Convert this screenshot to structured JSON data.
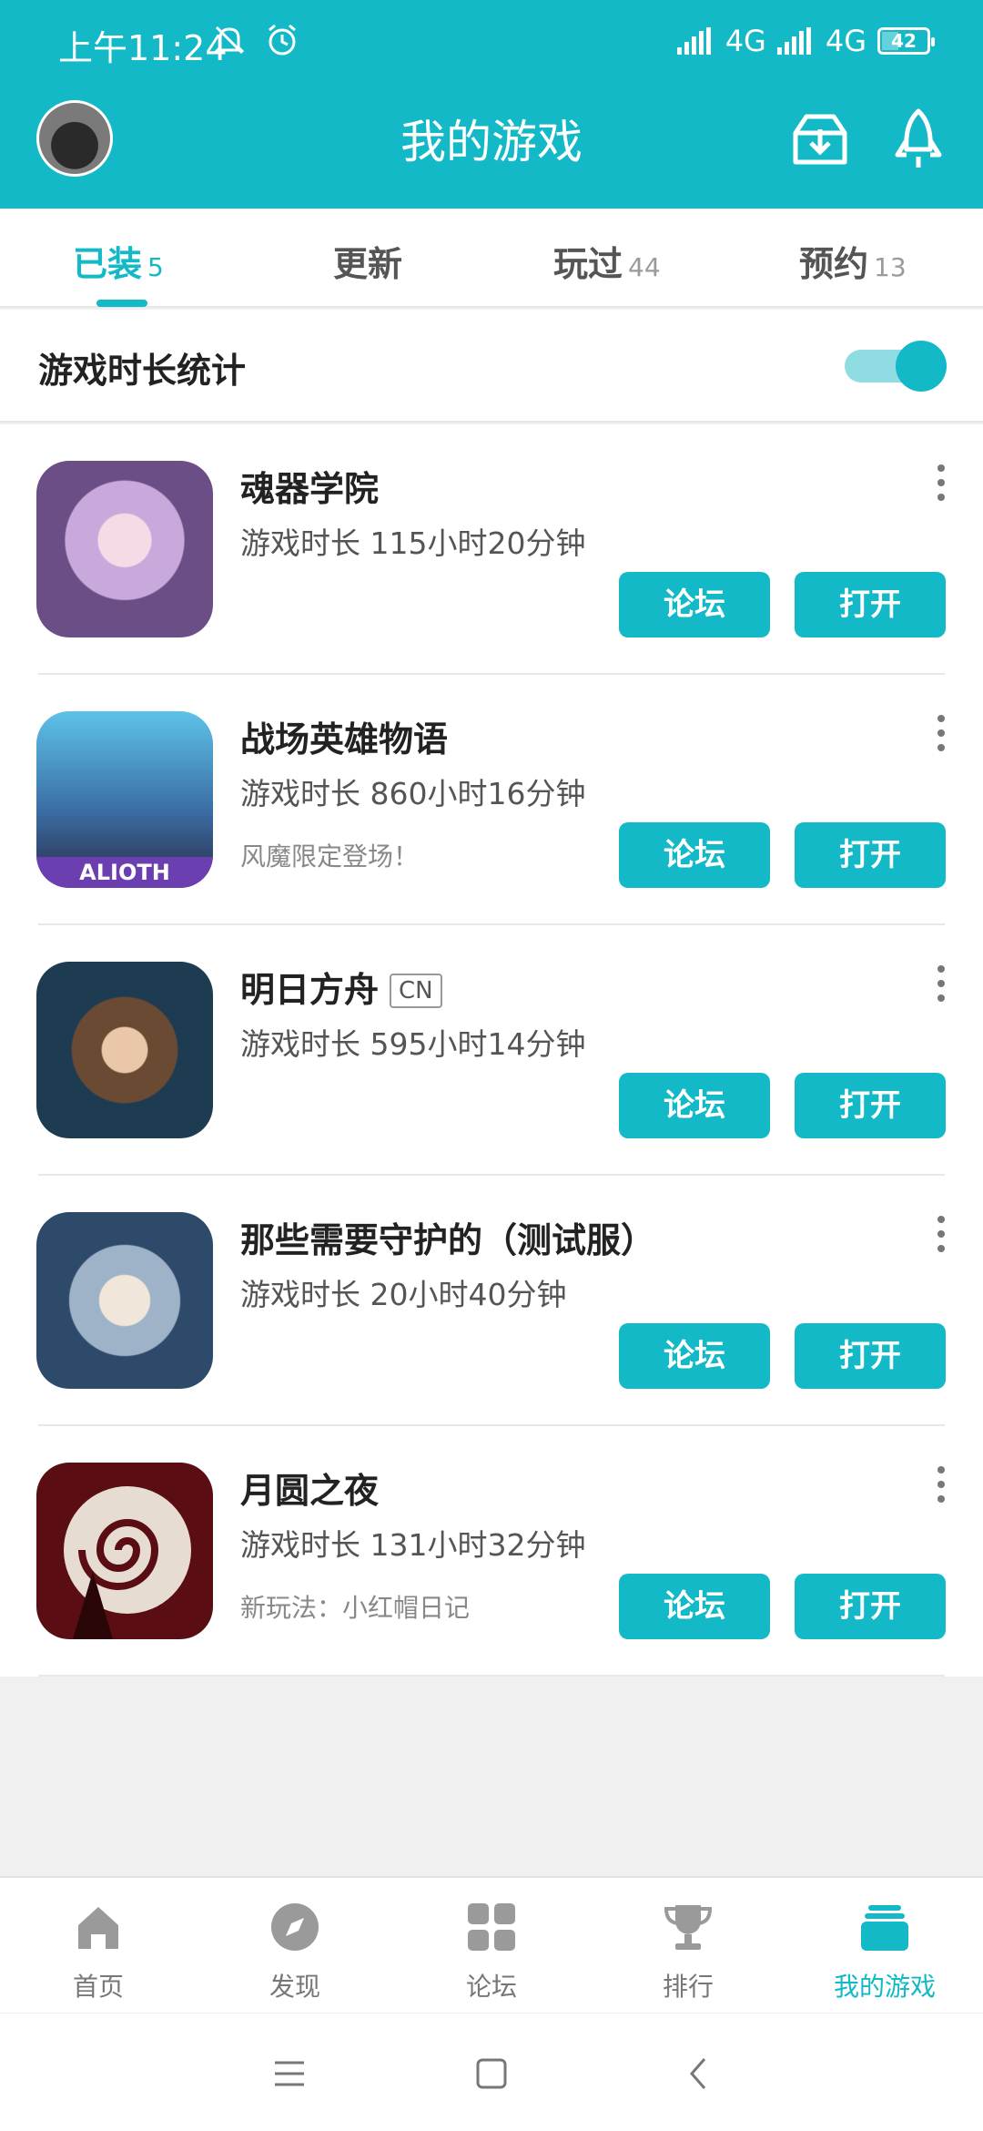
{
  "status_bar": {
    "time": "上午11:24",
    "network_1": "4G",
    "network_2": "4G",
    "battery": "42"
  },
  "header": {
    "title": "我的游戏",
    "icons": [
      "avatar",
      "download-manager-icon",
      "rocket-icon"
    ]
  },
  "tabs": [
    {
      "label": "已装",
      "count": "5"
    },
    {
      "label": "更新",
      "count": ""
    },
    {
      "label": "玩过",
      "count": "44"
    },
    {
      "label": "预约",
      "count": "13"
    }
  ],
  "playtime_stats": {
    "label": "游戏时长统计",
    "enabled": true
  },
  "games": [
    {
      "name": "魂器学院",
      "badge": "",
      "playtime": "游戏时长 115小时20分钟",
      "note": "",
      "forum_label": "论坛",
      "open_label": "打开"
    },
    {
      "name": "战场英雄物语",
      "badge": "",
      "playtime": "游戏时长 860小时16分钟",
      "note": "风魔限定登场！",
      "icon_text": "ALIOTH",
      "forum_label": "论坛",
      "open_label": "打开"
    },
    {
      "name": "明日方舟",
      "badge": "CN",
      "playtime": "游戏时长 595小时14分钟",
      "note": "",
      "forum_label": "论坛",
      "open_label": "打开"
    },
    {
      "name": "那些需要守护的（测试服）",
      "badge": "",
      "playtime": "游戏时长 20小时40分钟",
      "note": "",
      "forum_label": "论坛",
      "open_label": "打开"
    },
    {
      "name": "月圆之夜",
      "badge": "",
      "playtime": "游戏时长 131小时32分钟",
      "note": "新玩法：小红帽日记",
      "forum_label": "论坛",
      "open_label": "打开"
    }
  ],
  "bottom_nav": [
    {
      "label": "首页",
      "icon": "home-icon"
    },
    {
      "label": "发现",
      "icon": "compass-icon"
    },
    {
      "label": "论坛",
      "icon": "grid-icon"
    },
    {
      "label": "排行",
      "icon": "trophy-icon"
    },
    {
      "label": "我的游戏",
      "icon": "stack-icon",
      "active": true
    }
  ],
  "colors": {
    "accent": "#13b9c6",
    "background": "#f0f0f0"
  }
}
